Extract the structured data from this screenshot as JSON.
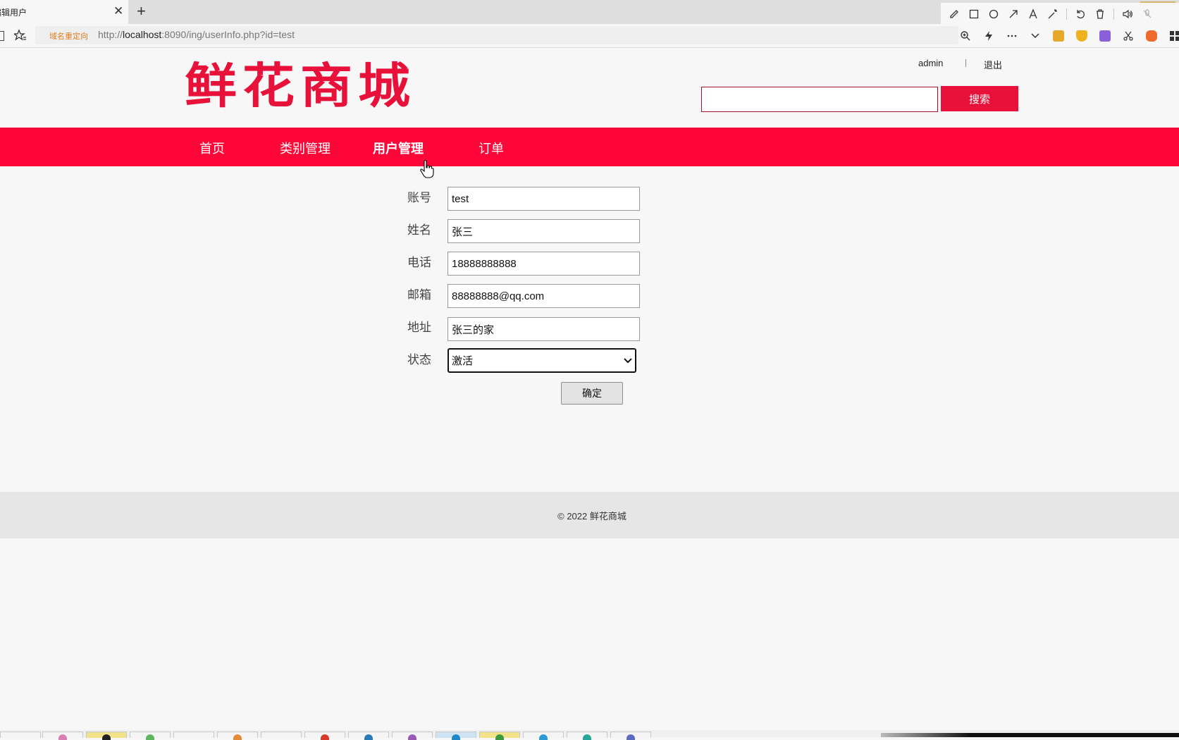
{
  "browser": {
    "tab_title": "编辑用户",
    "redirect_label": "域名重定向",
    "url_scheme": "http://",
    "url_host": "localhost",
    "url_rest": ":8090/ing/userInfo.php?id=test"
  },
  "header": {
    "logo_text": "鲜花商城",
    "username": "admin",
    "logout_label": "退出",
    "search_value": "",
    "search_button_label": "搜索"
  },
  "nav": {
    "items": [
      {
        "label": "首页"
      },
      {
        "label": "类别管理"
      },
      {
        "label": "用户管理",
        "active": true
      },
      {
        "label": "订单"
      }
    ]
  },
  "form": {
    "account_label": "账号",
    "account_value": "test",
    "name_label": "姓名",
    "name_value": "张三",
    "phone_label": "电话",
    "phone_value": "18888888888",
    "email_label": "邮箱",
    "email_value": "88888888@qq.com",
    "address_label": "地址",
    "address_value": "张三的家",
    "status_label": "状态",
    "status_selected": "激活",
    "submit_label": "确定"
  },
  "footer": {
    "text": "© 2022 鲜花商城"
  },
  "colors": {
    "brand_red": "#fe0637",
    "logo_red": "#e8113a",
    "page_bg": "#f7f7f7",
    "footer_bg": "#e6e6e6"
  }
}
